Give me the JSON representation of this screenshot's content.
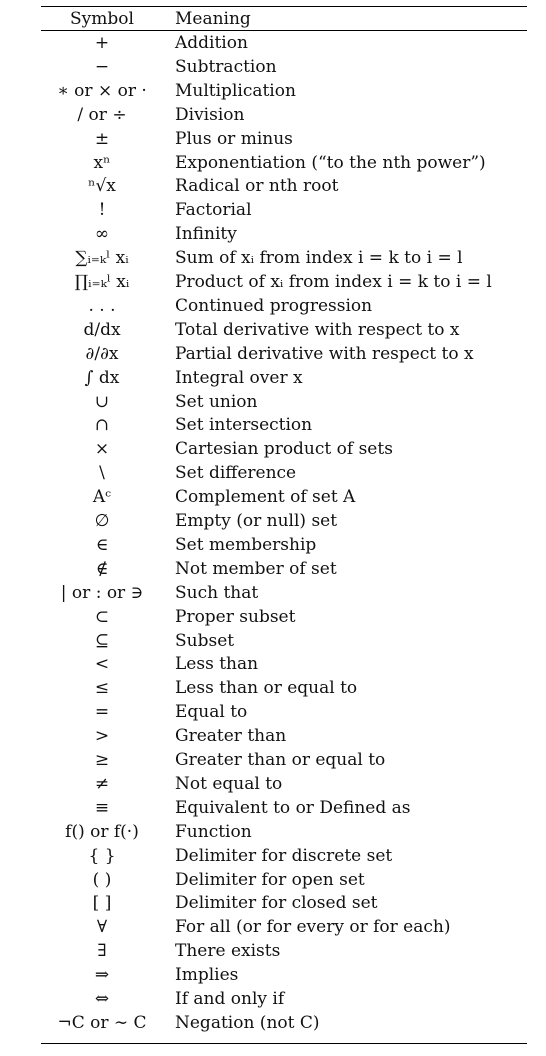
{
  "table": {
    "header": {
      "symbol": "Symbol",
      "meaning": "Meaning"
    },
    "rows": [
      {
        "symbol": "+",
        "meaning": "Addition"
      },
      {
        "symbol": "−",
        "meaning": "Subtraction"
      },
      {
        "symbol": "∗ or × or ·",
        "meaning": "Multiplication"
      },
      {
        "symbol": "/ or ÷",
        "meaning": "Division"
      },
      {
        "symbol": "±",
        "meaning": "Plus or minus"
      },
      {
        "symbol": "xⁿ",
        "meaning": "Exponentiation (“to the nth power”)"
      },
      {
        "symbol": "ⁿ√x",
        "meaning": "Radical or nth root"
      },
      {
        "symbol": "!",
        "meaning": "Factorial"
      },
      {
        "symbol": "∞",
        "meaning": "Infinity"
      },
      {
        "symbol": "∑ᵢ₌ₖˡ xᵢ",
        "meaning": "Sum of xᵢ from index i = k to i = l"
      },
      {
        "symbol": "∏ᵢ₌ₖˡ xᵢ",
        "meaning": "Product of xᵢ from index i = k to i = l"
      },
      {
        "symbol": ". . .",
        "meaning": "Continued progression"
      },
      {
        "symbol": "d/dx",
        "meaning": "Total derivative with respect to x"
      },
      {
        "symbol": "∂/∂x",
        "meaning": "Partial derivative with respect to x"
      },
      {
        "symbol": "∫ dx",
        "meaning": "Integral over x"
      },
      {
        "symbol": "∪",
        "meaning": "Set union"
      },
      {
        "symbol": "∩",
        "meaning": "Set intersection"
      },
      {
        "symbol": "×",
        "meaning": "Cartesian product of sets"
      },
      {
        "symbol": "\\",
        "meaning": "Set difference"
      },
      {
        "symbol": "Aᶜ",
        "meaning": "Complement of set A"
      },
      {
        "symbol": "∅",
        "meaning": "Empty (or null) set"
      },
      {
        "symbol": "∈",
        "meaning": "Set membership"
      },
      {
        "symbol": "∉",
        "meaning": "Not member of set"
      },
      {
        "symbol": "| or : or ∋",
        "meaning": "Such that"
      },
      {
        "symbol": "⊂",
        "meaning": "Proper subset"
      },
      {
        "symbol": "⊆",
        "meaning": "Subset"
      },
      {
        "symbol": "<",
        "meaning": "Less than"
      },
      {
        "symbol": "≤",
        "meaning": "Less than or equal to"
      },
      {
        "symbol": "=",
        "meaning": "Equal to"
      },
      {
        "symbol": ">",
        "meaning": "Greater than"
      },
      {
        "symbol": "≥",
        "meaning": "Greater than or equal to"
      },
      {
        "symbol": "≠",
        "meaning": "Not equal to"
      },
      {
        "symbol": "≡",
        "meaning": "Equivalent to or Defined as"
      },
      {
        "symbol": "f() or f(·)",
        "meaning": "Function"
      },
      {
        "symbol": "{ }",
        "meaning": "Delimiter for discrete set"
      },
      {
        "symbol": "( )",
        "meaning": "Delimiter for open set"
      },
      {
        "symbol": "[ ]",
        "meaning": "Delimiter for closed set"
      },
      {
        "symbol": "∀",
        "meaning": "For all (or for every or for each)"
      },
      {
        "symbol": "∃",
        "meaning": "There exists"
      },
      {
        "symbol": "⇒",
        "meaning": "Implies"
      },
      {
        "symbol": "⇔",
        "meaning": "If and only if"
      },
      {
        "symbol": "¬C or ∼ C",
        "meaning": "Negation (not C)"
      }
    ]
  }
}
